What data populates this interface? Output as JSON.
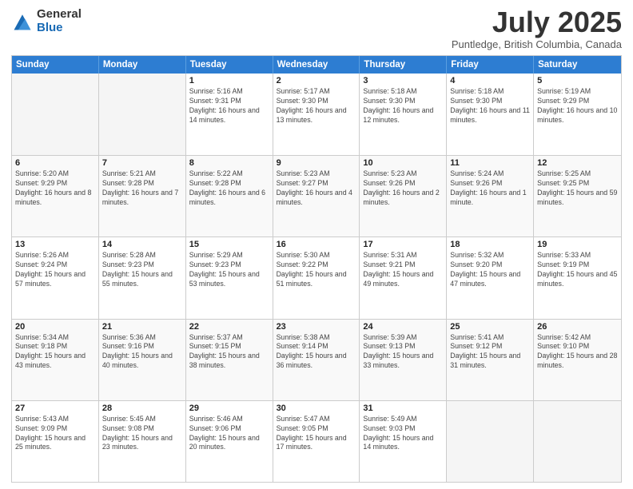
{
  "header": {
    "logo": {
      "general": "General",
      "blue": "Blue"
    },
    "title": "July 2025",
    "location": "Puntledge, British Columbia, Canada"
  },
  "calendar": {
    "days_of_week": [
      "Sunday",
      "Monday",
      "Tuesday",
      "Wednesday",
      "Thursday",
      "Friday",
      "Saturday"
    ],
    "weeks": [
      [
        {
          "day": "",
          "empty": true
        },
        {
          "day": "",
          "empty": true
        },
        {
          "day": "1",
          "sunrise": "5:16 AM",
          "sunset": "9:31 PM",
          "daylight": "16 hours and 14 minutes."
        },
        {
          "day": "2",
          "sunrise": "5:17 AM",
          "sunset": "9:30 PM",
          "daylight": "16 hours and 13 minutes."
        },
        {
          "day": "3",
          "sunrise": "5:18 AM",
          "sunset": "9:30 PM",
          "daylight": "16 hours and 12 minutes."
        },
        {
          "day": "4",
          "sunrise": "5:18 AM",
          "sunset": "9:30 PM",
          "daylight": "16 hours and 11 minutes."
        },
        {
          "day": "5",
          "sunrise": "5:19 AM",
          "sunset": "9:29 PM",
          "daylight": "16 hours and 10 minutes."
        }
      ],
      [
        {
          "day": "6",
          "sunrise": "5:20 AM",
          "sunset": "9:29 PM",
          "daylight": "16 hours and 8 minutes."
        },
        {
          "day": "7",
          "sunrise": "5:21 AM",
          "sunset": "9:28 PM",
          "daylight": "16 hours and 7 minutes."
        },
        {
          "day": "8",
          "sunrise": "5:22 AM",
          "sunset": "9:28 PM",
          "daylight": "16 hours and 6 minutes."
        },
        {
          "day": "9",
          "sunrise": "5:23 AM",
          "sunset": "9:27 PM",
          "daylight": "16 hours and 4 minutes."
        },
        {
          "day": "10",
          "sunrise": "5:23 AM",
          "sunset": "9:26 PM",
          "daylight": "16 hours and 2 minutes."
        },
        {
          "day": "11",
          "sunrise": "5:24 AM",
          "sunset": "9:26 PM",
          "daylight": "16 hours and 1 minute."
        },
        {
          "day": "12",
          "sunrise": "5:25 AM",
          "sunset": "9:25 PM",
          "daylight": "15 hours and 59 minutes."
        }
      ],
      [
        {
          "day": "13",
          "sunrise": "5:26 AM",
          "sunset": "9:24 PM",
          "daylight": "15 hours and 57 minutes."
        },
        {
          "day": "14",
          "sunrise": "5:28 AM",
          "sunset": "9:23 PM",
          "daylight": "15 hours and 55 minutes."
        },
        {
          "day": "15",
          "sunrise": "5:29 AM",
          "sunset": "9:23 PM",
          "daylight": "15 hours and 53 minutes."
        },
        {
          "day": "16",
          "sunrise": "5:30 AM",
          "sunset": "9:22 PM",
          "daylight": "15 hours and 51 minutes."
        },
        {
          "day": "17",
          "sunrise": "5:31 AM",
          "sunset": "9:21 PM",
          "daylight": "15 hours and 49 minutes."
        },
        {
          "day": "18",
          "sunrise": "5:32 AM",
          "sunset": "9:20 PM",
          "daylight": "15 hours and 47 minutes."
        },
        {
          "day": "19",
          "sunrise": "5:33 AM",
          "sunset": "9:19 PM",
          "daylight": "15 hours and 45 minutes."
        }
      ],
      [
        {
          "day": "20",
          "sunrise": "5:34 AM",
          "sunset": "9:18 PM",
          "daylight": "15 hours and 43 minutes."
        },
        {
          "day": "21",
          "sunrise": "5:36 AM",
          "sunset": "9:16 PM",
          "daylight": "15 hours and 40 minutes."
        },
        {
          "day": "22",
          "sunrise": "5:37 AM",
          "sunset": "9:15 PM",
          "daylight": "15 hours and 38 minutes."
        },
        {
          "day": "23",
          "sunrise": "5:38 AM",
          "sunset": "9:14 PM",
          "daylight": "15 hours and 36 minutes."
        },
        {
          "day": "24",
          "sunrise": "5:39 AM",
          "sunset": "9:13 PM",
          "daylight": "15 hours and 33 minutes."
        },
        {
          "day": "25",
          "sunrise": "5:41 AM",
          "sunset": "9:12 PM",
          "daylight": "15 hours and 31 minutes."
        },
        {
          "day": "26",
          "sunrise": "5:42 AM",
          "sunset": "9:10 PM",
          "daylight": "15 hours and 28 minutes."
        }
      ],
      [
        {
          "day": "27",
          "sunrise": "5:43 AM",
          "sunset": "9:09 PM",
          "daylight": "15 hours and 25 minutes."
        },
        {
          "day": "28",
          "sunrise": "5:45 AM",
          "sunset": "9:08 PM",
          "daylight": "15 hours and 23 minutes."
        },
        {
          "day": "29",
          "sunrise": "5:46 AM",
          "sunset": "9:06 PM",
          "daylight": "15 hours and 20 minutes."
        },
        {
          "day": "30",
          "sunrise": "5:47 AM",
          "sunset": "9:05 PM",
          "daylight": "15 hours and 17 minutes."
        },
        {
          "day": "31",
          "sunrise": "5:49 AM",
          "sunset": "9:03 PM",
          "daylight": "15 hours and 14 minutes."
        },
        {
          "day": "",
          "empty": true
        },
        {
          "day": "",
          "empty": true
        }
      ]
    ]
  }
}
